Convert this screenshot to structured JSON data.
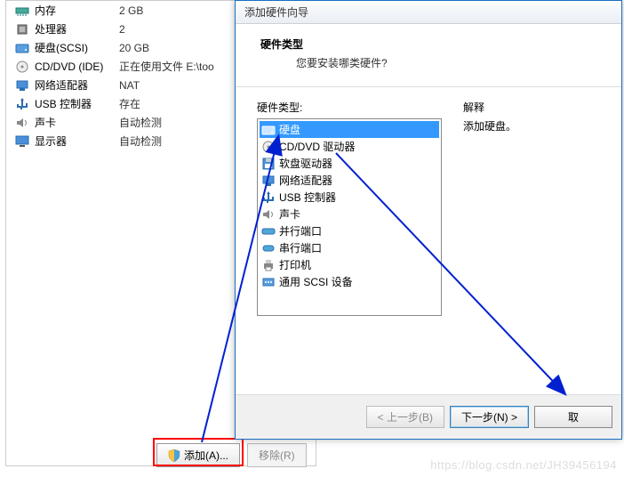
{
  "settings": {
    "rows": [
      {
        "icon": "memory-icon",
        "label": "内存",
        "value": "2 GB"
      },
      {
        "icon": "cpu-icon",
        "label": "处理器",
        "value": "2"
      },
      {
        "icon": "hdd-icon",
        "label": "硬盘(SCSI)",
        "value": "20 GB"
      },
      {
        "icon": "cd-icon",
        "label": "CD/DVD (IDE)",
        "value": "正在使用文件 E:\\too"
      },
      {
        "icon": "net-icon",
        "label": "网络适配器",
        "value": "NAT"
      },
      {
        "icon": "usb-icon",
        "label": "USB 控制器",
        "value": "存在"
      },
      {
        "icon": "sound-icon",
        "label": "声卡",
        "value": "自动检测"
      },
      {
        "icon": "display-icon",
        "label": "显示器",
        "value": "自动检测"
      }
    ]
  },
  "buttons": {
    "add": "添加(A)...",
    "remove": "移除(R)"
  },
  "dialog": {
    "title": "添加硬件向导",
    "header_title": "硬件类型",
    "header_sub": "您要安装哪类硬件?",
    "list_label": "硬件类型:",
    "desc_label": "解释",
    "desc_text": "添加硬盘。",
    "items": [
      {
        "icon": "hdd-icon",
        "label": "硬盘",
        "selected": true
      },
      {
        "icon": "cd-icon",
        "label": "CD/DVD 驱动器"
      },
      {
        "icon": "floppy-icon",
        "label": "软盘驱动器"
      },
      {
        "icon": "net-icon",
        "label": "网络适配器"
      },
      {
        "icon": "usb-icon",
        "label": "USB 控制器"
      },
      {
        "icon": "sound-icon",
        "label": "声卡"
      },
      {
        "icon": "parallel-icon",
        "label": "并行端口"
      },
      {
        "icon": "serial-icon",
        "label": "串行端口"
      },
      {
        "icon": "printer-icon",
        "label": "打印机"
      },
      {
        "icon": "scsi-icon",
        "label": "通用 SCSI 设备"
      }
    ],
    "back": "< 上一步(B)",
    "next": "下一步(N) >",
    "cancel": "取"
  },
  "watermark": "https://blog.csdn.net/JH39456194"
}
